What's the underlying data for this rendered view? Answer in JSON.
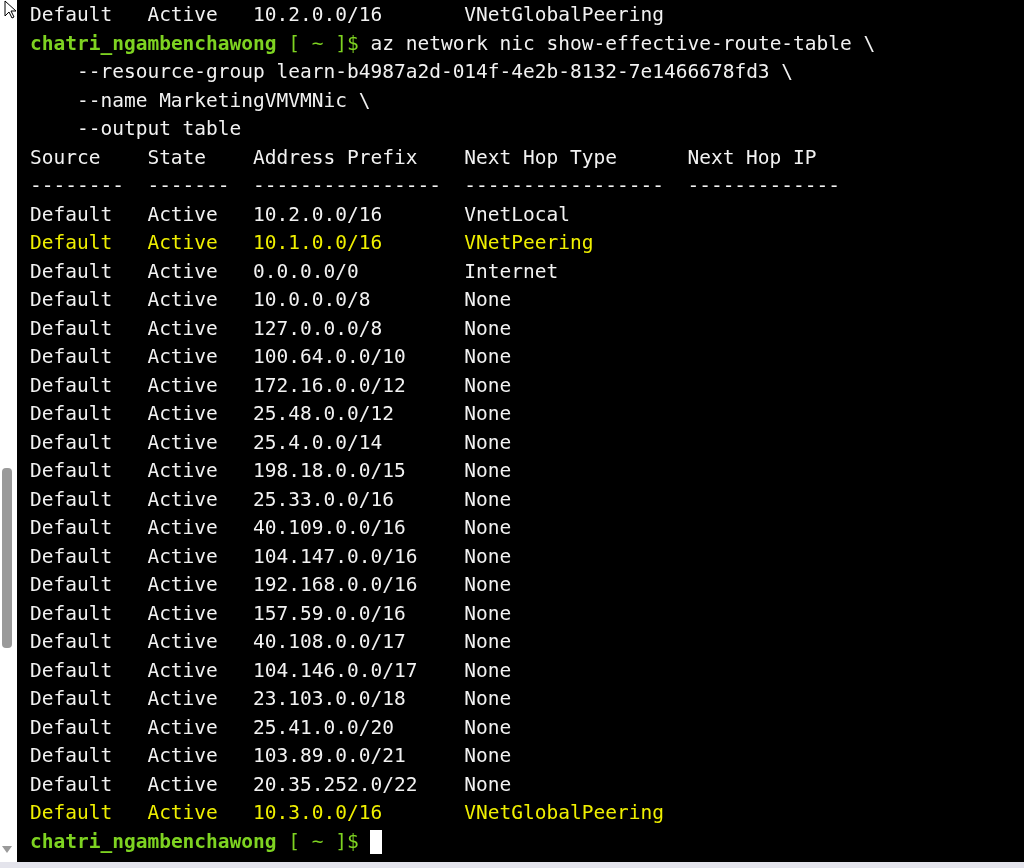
{
  "earlier_output": [
    {
      "cells": [
        "Default",
        "Active",
        "10.2.0.0/16",
        "VNetGlobalPeering"
      ],
      "highlighted": false
    }
  ],
  "command": {
    "user": "chatri_ngambenchawong",
    "path": "[ ~ ]$",
    "text": "az network nic show-effective-route-table \\",
    "continuation": [
      "--resource-group learn-b4987a2d-014f-4e2b-8132-7e1466678fd3 \\",
      "--name MarketingVMVMNic \\",
      "--output table"
    ]
  },
  "table": {
    "columns": [
      "Source",
      "State",
      "Address Prefix",
      "Next Hop Type",
      "Next Hop IP"
    ],
    "separators": [
      "--------",
      "-------",
      "----------------",
      "-----------------",
      "-------------"
    ],
    "rows": [
      {
        "cells": [
          "Default",
          "Active",
          "10.2.0.0/16",
          "VnetLocal"
        ],
        "highlighted": false
      },
      {
        "cells": [
          "Default",
          "Active",
          "10.1.0.0/16",
          "VNetPeering"
        ],
        "highlighted": true
      },
      {
        "cells": [
          "Default",
          "Active",
          "0.0.0.0/0",
          "Internet"
        ],
        "highlighted": false
      },
      {
        "cells": [
          "Default",
          "Active",
          "10.0.0.0/8",
          "None"
        ],
        "highlighted": false
      },
      {
        "cells": [
          "Default",
          "Active",
          "127.0.0.0/8",
          "None"
        ],
        "highlighted": false
      },
      {
        "cells": [
          "Default",
          "Active",
          "100.64.0.0/10",
          "None"
        ],
        "highlighted": false
      },
      {
        "cells": [
          "Default",
          "Active",
          "172.16.0.0/12",
          "None"
        ],
        "highlighted": false
      },
      {
        "cells": [
          "Default",
          "Active",
          "25.48.0.0/12",
          "None"
        ],
        "highlighted": false
      },
      {
        "cells": [
          "Default",
          "Active",
          "25.4.0.0/14",
          "None"
        ],
        "highlighted": false
      },
      {
        "cells": [
          "Default",
          "Active",
          "198.18.0.0/15",
          "None"
        ],
        "highlighted": false
      },
      {
        "cells": [
          "Default",
          "Active",
          "25.33.0.0/16",
          "None"
        ],
        "highlighted": false
      },
      {
        "cells": [
          "Default",
          "Active",
          "40.109.0.0/16",
          "None"
        ],
        "highlighted": false
      },
      {
        "cells": [
          "Default",
          "Active",
          "104.147.0.0/16",
          "None"
        ],
        "highlighted": false
      },
      {
        "cells": [
          "Default",
          "Active",
          "192.168.0.0/16",
          "None"
        ],
        "highlighted": false
      },
      {
        "cells": [
          "Default",
          "Active",
          "157.59.0.0/16",
          "None"
        ],
        "highlighted": false
      },
      {
        "cells": [
          "Default",
          "Active",
          "40.108.0.0/17",
          "None"
        ],
        "highlighted": false
      },
      {
        "cells": [
          "Default",
          "Active",
          "104.146.0.0/17",
          "None"
        ],
        "highlighted": false
      },
      {
        "cells": [
          "Default",
          "Active",
          "23.103.0.0/18",
          "None"
        ],
        "highlighted": false
      },
      {
        "cells": [
          "Default",
          "Active",
          "25.41.0.0/20",
          "None"
        ],
        "highlighted": false
      },
      {
        "cells": [
          "Default",
          "Active",
          "103.89.0.0/21",
          "None"
        ],
        "highlighted": false
      },
      {
        "cells": [
          "Default",
          "Active",
          "20.35.252.0/22",
          "None"
        ],
        "highlighted": false
      },
      {
        "cells": [
          "Default",
          "Active",
          "10.3.0.0/16",
          "VNetGlobalPeering"
        ],
        "highlighted": true
      }
    ]
  },
  "final_prompt": {
    "user": "chatri_ngambenchawong",
    "path": "[ ~ ]$",
    "cursor": true
  }
}
